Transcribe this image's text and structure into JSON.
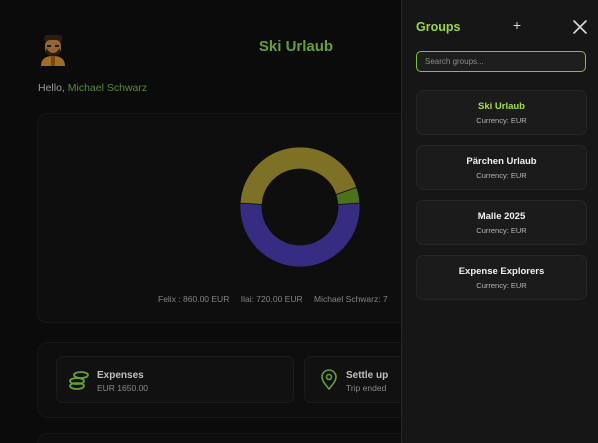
{
  "header": {
    "group_title": "Ski Urlaub"
  },
  "greeting": {
    "prefix": "Hello, ",
    "name": "Michael Schwarz"
  },
  "chart_data": {
    "type": "pie",
    "style": "donut",
    "categories": [
      "Felix",
      "Ilai",
      "Michael Schwarz"
    ],
    "values": [
      860,
      720,
      70
    ],
    "colors": [
      "#4338a0",
      "#9a8a2e",
      "#5d8a24"
    ],
    "legend": [
      {
        "label": "Felix : 860.00 EUR"
      },
      {
        "label": "Ilai: 720.00 EUR"
      },
      {
        "label": "Michael Schwarz: 7"
      }
    ]
  },
  "tiles": {
    "expenses": {
      "title": "Expenses",
      "subtitle": "EUR 1650.00",
      "icon": "coins-icon"
    },
    "settle": {
      "title": "Settle up",
      "subtitle": "Trip ended",
      "icon": "location-pin-icon"
    }
  },
  "drawer": {
    "title": "Groups",
    "add_label": "+",
    "search_placeholder": "Search groups...",
    "groups": [
      {
        "name": "Ski Urlaub",
        "currency": "Currency: EUR",
        "active": true
      },
      {
        "name": "Pärchen Urlaub",
        "currency": "Currency: EUR",
        "active": false
      },
      {
        "name": "Malle 2025",
        "currency": "Currency: EUR",
        "active": false
      },
      {
        "name": "Expense Explorers",
        "currency": "Currency: EUR",
        "active": false
      }
    ]
  },
  "colors": {
    "accent": "#7cc242",
    "background": "#0e0e0e",
    "drawer": "#161616"
  }
}
